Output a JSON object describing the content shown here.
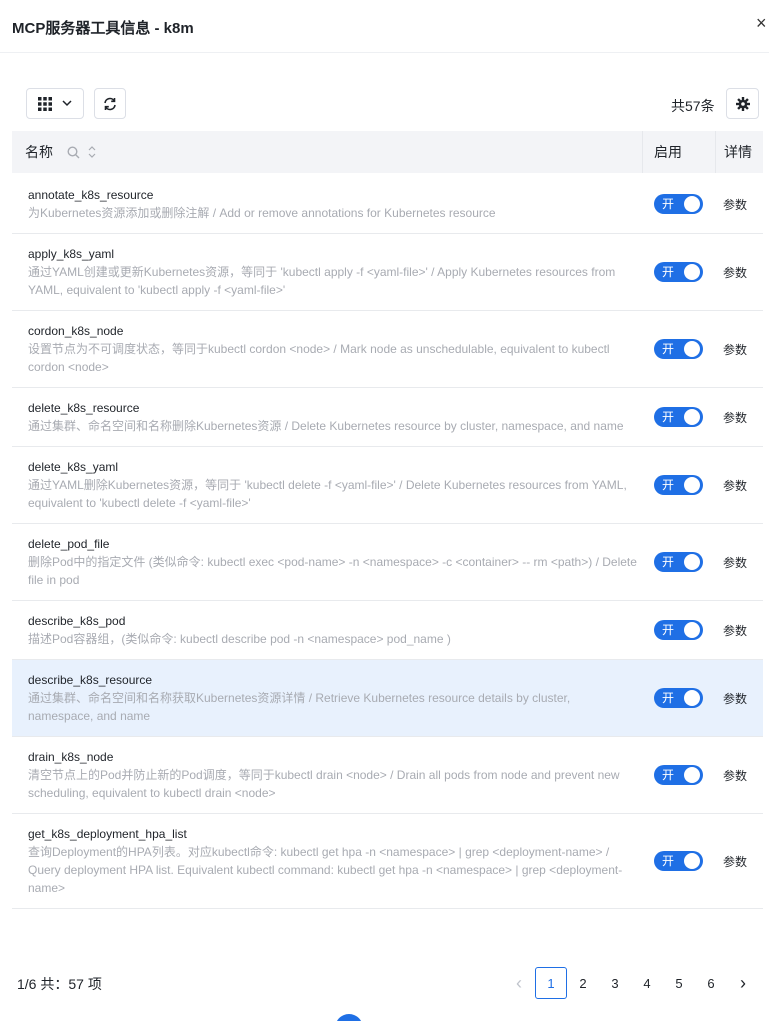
{
  "modal": {
    "title": "MCP服务器工具信息 - k8m",
    "close_glyph": "×"
  },
  "toolbar": {
    "total": "共57条",
    "view_icon": "grid-icon",
    "refresh_icon": "refresh-icon",
    "settings_icon": "gear-icon"
  },
  "table": {
    "headers": {
      "name": "名称",
      "enable": "启用",
      "detail": "详情"
    },
    "toggle_label": "开",
    "detail_label": "参数",
    "rows": [
      {
        "name": "annotate_k8s_resource",
        "desc": "为Kubernetes资源添加或删除注解 / Add or remove annotations for Kubernetes resource",
        "enabled": true
      },
      {
        "name": "apply_k8s_yaml",
        "desc": "通过YAML创建或更新Kubernetes资源，等同于 'kubectl apply -f <yaml-file>' / Apply Kubernetes resources from YAML, equivalent to 'kubectl apply -f <yaml-file>'",
        "enabled": true
      },
      {
        "name": "cordon_k8s_node",
        "desc": "设置节点为不可调度状态，等同于kubectl cordon <node> / Mark node as unschedulable, equivalent to kubectl cordon <node>",
        "enabled": true
      },
      {
        "name": "delete_k8s_resource",
        "desc": "通过集群、命名空间和名称删除Kubernetes资源 / Delete Kubernetes resource by cluster, namespace, and name",
        "enabled": true
      },
      {
        "name": "delete_k8s_yaml",
        "desc": "通过YAML删除Kubernetes资源，等同于 'kubectl delete -f <yaml-file>' / Delete Kubernetes resources from YAML, equivalent to 'kubectl delete -f <yaml-file>'",
        "enabled": true
      },
      {
        "name": "delete_pod_file",
        "desc": "删除Pod中的指定文件 (类似命令: kubectl exec <pod-name> -n <namespace> -c <container> -- rm <path>) / Delete file in pod",
        "enabled": true
      },
      {
        "name": "describe_k8s_pod",
        "desc": "描述Pod容器组，(类似命令: kubectl describe pod -n <namespace> pod_name )",
        "enabled": true
      },
      {
        "name": "describe_k8s_resource",
        "desc": "通过集群、命名空间和名称获取Kubernetes资源详情 / Retrieve Kubernetes resource details by cluster, namespace, and name",
        "enabled": true,
        "selected": true
      },
      {
        "name": "drain_k8s_node",
        "desc": "清空节点上的Pod并防止新的Pod调度，等同于kubectl drain <node> / Drain all pods from node and prevent new scheduling, equivalent to kubectl drain <node>",
        "enabled": true
      },
      {
        "name": "get_k8s_deployment_hpa_list",
        "desc": "查询Deployment的HPA列表。对应kubectl命令: kubectl get hpa -n <namespace> | grep <deployment-name> / Query deployment HPA list. Equivalent kubectl command: kubectl get hpa -n <namespace> | grep <deployment-name>",
        "enabled": true
      }
    ]
  },
  "pagination": {
    "info": "1/6 共：57 项",
    "prev": "‹",
    "next": "›",
    "pages": [
      "1",
      "2",
      "3",
      "4",
      "5",
      "6"
    ],
    "current": "1"
  },
  "colors": {
    "primary": "#1f6fe5",
    "selected_row": "#e8f1fd",
    "header_bg": "#f3f4f7"
  }
}
